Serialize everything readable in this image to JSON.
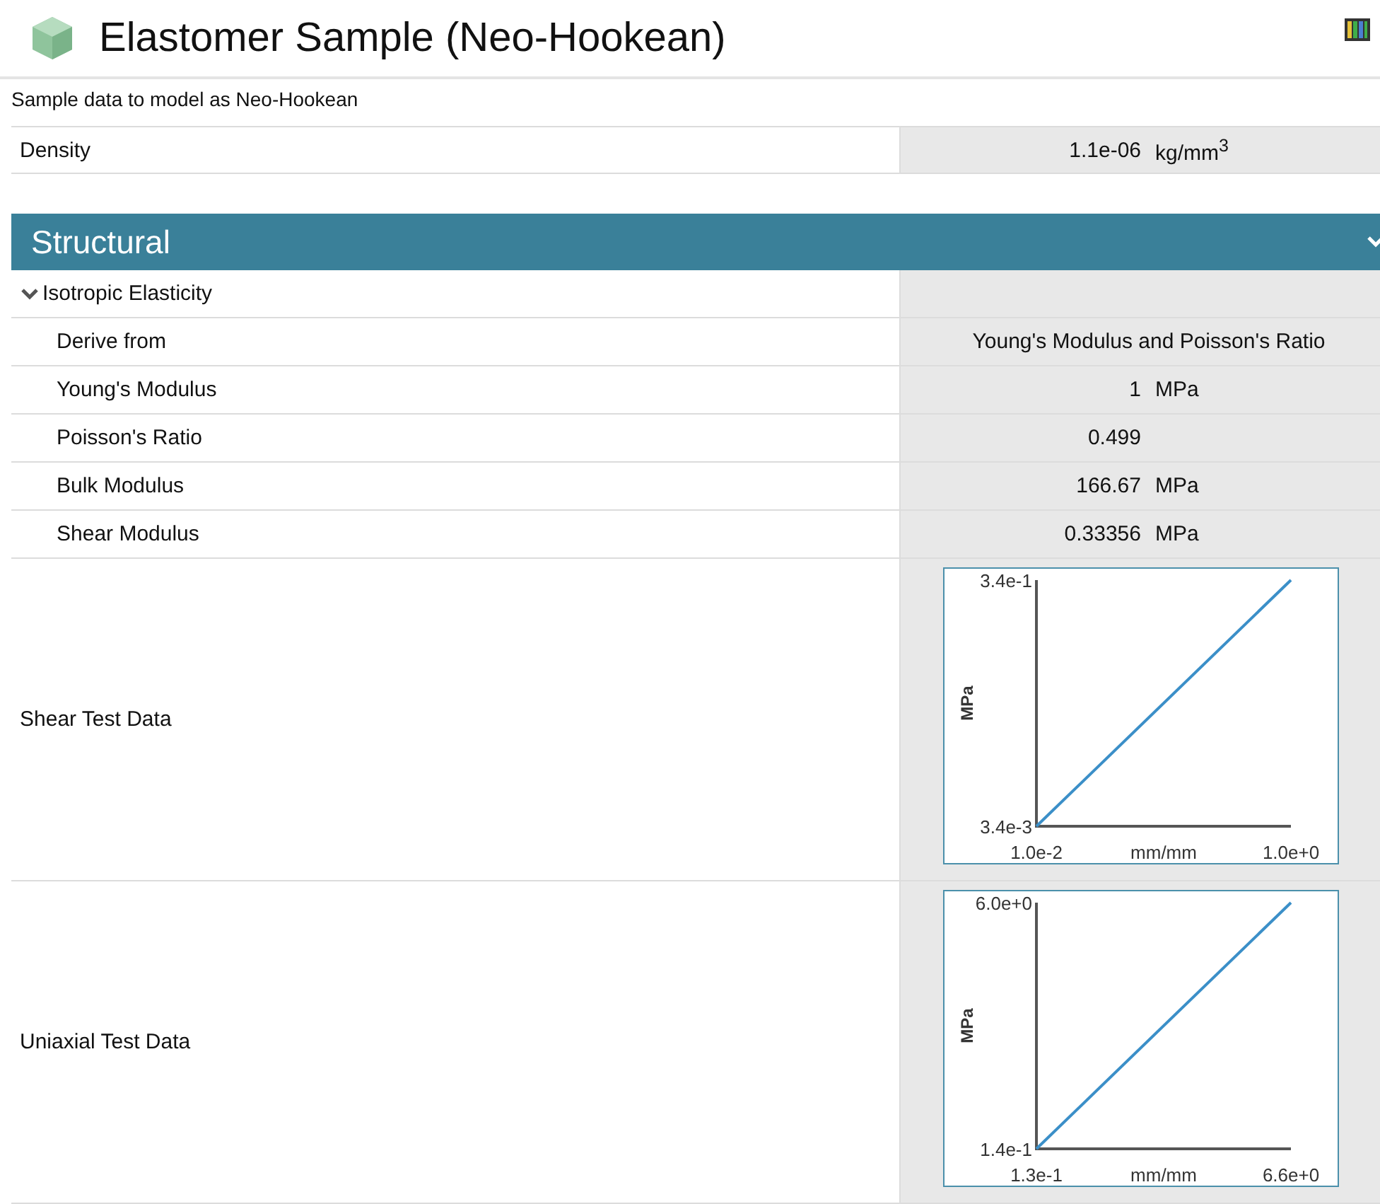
{
  "header": {
    "title": "Elastomer Sample (Neo-Hookean)",
    "description": "Sample data to model as Neo-Hookean"
  },
  "density": {
    "label": "Density",
    "value": "1.1e-06",
    "unit": "kg/mm$^{3}$"
  },
  "section": {
    "title": "Structural",
    "expanded": true
  },
  "group": {
    "label": "Isotropic Elasticity",
    "expanded": true,
    "rows": [
      {
        "kind": "choice",
        "label": "Derive from",
        "value": "Young's Modulus and Poisson's Ratio"
      },
      {
        "kind": "quantity",
        "label": "Young's Modulus",
        "value": "1",
        "unit": "MPa"
      },
      {
        "kind": "quantity",
        "label": "Poisson's Ratio",
        "value": "0.499"
      },
      {
        "kind": "quantity",
        "label": "Bulk Modulus",
        "value": "166.67",
        "unit": "MPa"
      },
      {
        "kind": "quantity",
        "label": "Shear Modulus",
        "value": "0.33356",
        "unit": "MPa"
      }
    ]
  },
  "test_data": [
    {
      "label": "Shear Test Data",
      "chart_data": {
        "type": "line",
        "xlabel": "mm/mm",
        "ylabel": "MPa",
        "x": [
          0.01,
          1.0
        ],
        "series": [
          {
            "color": "#3b8fc8",
            "values": [
              0.0034,
              0.34
            ]
          }
        ],
        "xlim": [
          0.01,
          1.0
        ],
        "ylim": [
          0.0034,
          0.34
        ],
        "xticks": [
          {
            "value": 0.01,
            "label": "1.0e-2"
          },
          {
            "value": 1.0,
            "label": "1.0e+0"
          }
        ],
        "yticks": [
          {
            "value": 0.0034,
            "label": "3.4e-3"
          },
          {
            "value": 0.34,
            "label": "3.4e-1"
          }
        ]
      }
    },
    {
      "label": "Uniaxial Test Data",
      "chart_data": {
        "type": "line",
        "xlabel": "mm/mm",
        "ylabel": "MPa",
        "x": [
          0.13,
          6.6
        ],
        "series": [
          {
            "color": "#3b8fc8",
            "values": [
              0.14,
              6.0
            ]
          }
        ],
        "xlim": [
          0.13,
          6.6
        ],
        "ylim": [
          0.14,
          6.0
        ],
        "xticks": [
          {
            "value": 0.13,
            "label": "1.3e-1"
          },
          {
            "value": 6.6,
            "label": "6.6e+0"
          }
        ],
        "yticks": [
          {
            "value": 0.14,
            "label": "1.4e-1"
          },
          {
            "value": 6.0,
            "label": "6.0e+0"
          }
        ]
      }
    }
  ]
}
